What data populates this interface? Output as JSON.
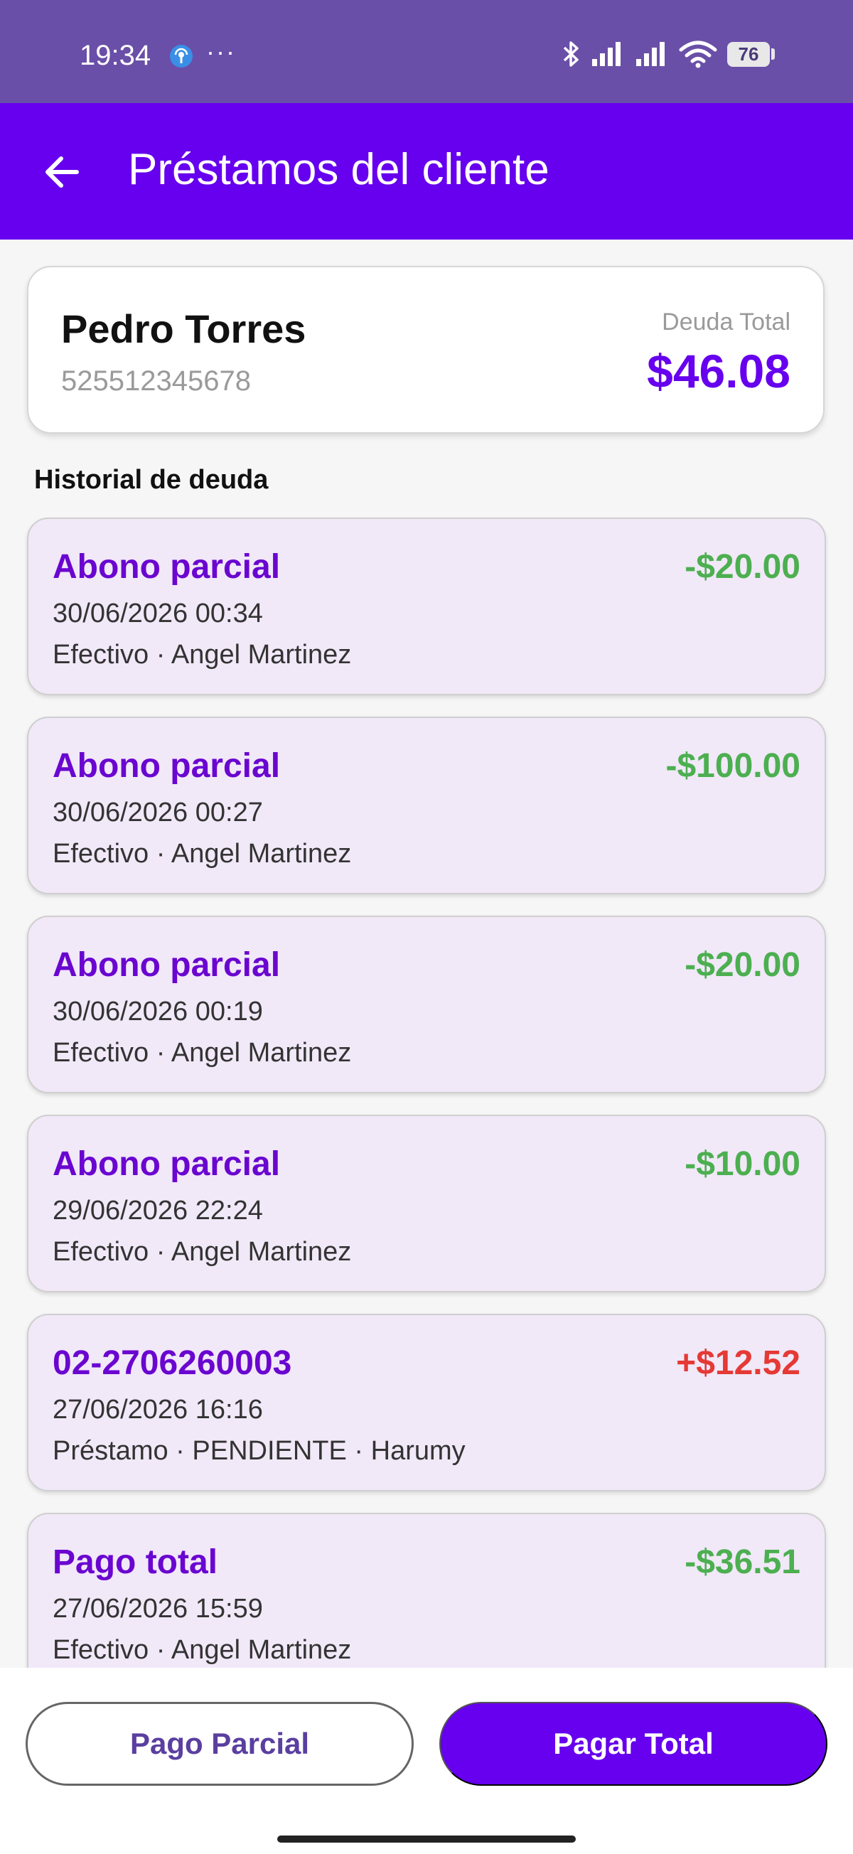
{
  "status_bar": {
    "time": "19:34",
    "more": "···",
    "battery": "76"
  },
  "app_bar": {
    "title": "Préstamos del cliente"
  },
  "client": {
    "name": "Pedro Torres",
    "phone": "525512345678",
    "debt_label": "Deuda Total",
    "debt_amount": "$46.08"
  },
  "history": {
    "title": "Historial de deuda",
    "items": [
      {
        "title": "Abono parcial",
        "amount": "-$20.00",
        "date": "30/06/2026 00:34",
        "detail": "Efectivo · Angel Martinez",
        "amount_color": "#4caf50"
      },
      {
        "title": "Abono parcial",
        "amount": "-$100.00",
        "date": "30/06/2026 00:27",
        "detail": "Efectivo · Angel Martinez",
        "amount_color": "#4caf50"
      },
      {
        "title": "Abono parcial",
        "amount": "-$20.00",
        "date": "30/06/2026 00:19",
        "detail": "Efectivo · Angel Martinez",
        "amount_color": "#4caf50"
      },
      {
        "title": "Abono parcial",
        "amount": "-$10.00",
        "date": "29/06/2026 22:24",
        "detail": "Efectivo · Angel Martinez",
        "amount_color": "#4caf50"
      },
      {
        "title": "02-2706260003",
        "amount": "+$12.52",
        "date": "27/06/2026 16:16",
        "detail": "Préstamo · PENDIENTE · Harumy",
        "amount_color": "#e53935"
      },
      {
        "title": "Pago total",
        "amount": "-$36.51",
        "date": "27/06/2026 15:59",
        "detail": "Efectivo · Angel Martinez",
        "amount_color": "#4caf50"
      }
    ]
  },
  "actions": {
    "partial_label": "Pago Parcial",
    "total_label": "Pagar Total"
  },
  "colors": {
    "primary": "#6600ee",
    "status_bar": "#6a4fa8",
    "card_bg": "#f1e8f8",
    "negative": "#4caf50",
    "positive": "#e53935"
  },
  "icons": {
    "back": "arrow-left-icon",
    "hotspot": "hotspot-icon",
    "bluetooth": "bluetooth-icon",
    "signal": "signal-icon",
    "wifi": "wifi-icon",
    "battery": "battery-icon"
  }
}
